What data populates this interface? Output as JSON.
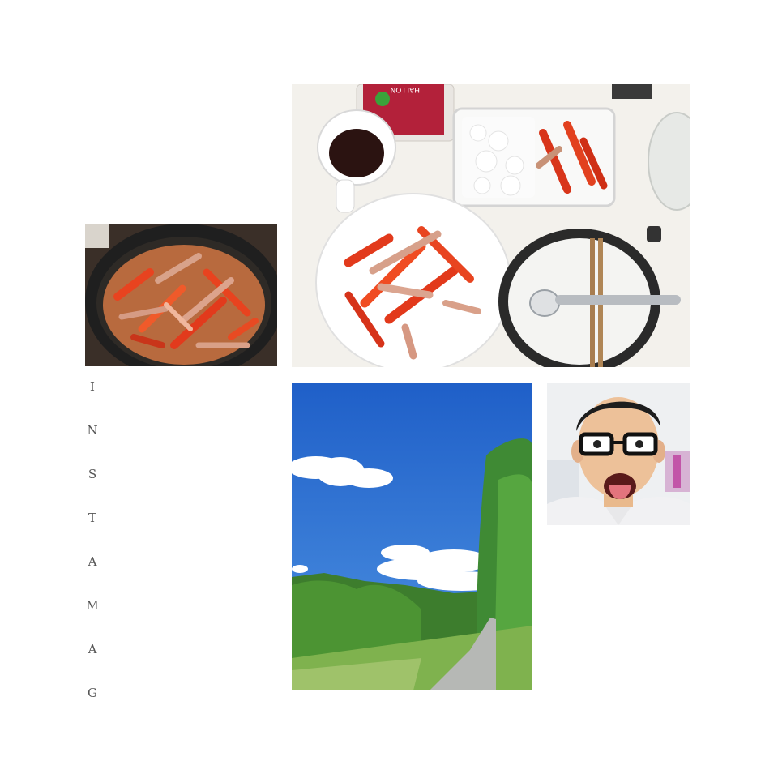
{
  "collage": {
    "word_letters": [
      "I",
      "N",
      "S",
      "T",
      "A",
      "M",
      "A",
      "G"
    ],
    "package_label": "HALLON",
    "colors": {
      "background": "#ffffff",
      "sky": "#2f74d6",
      "pepper": "#e23a1c",
      "pan": "#2a2a2a"
    }
  }
}
